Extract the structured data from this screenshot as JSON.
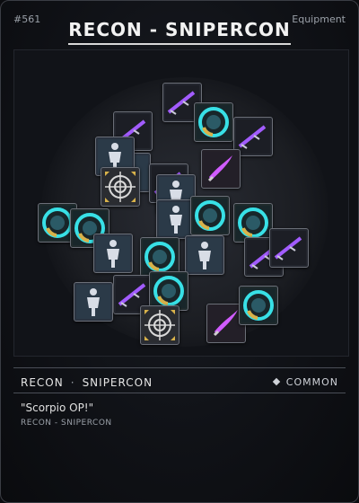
{
  "card": {
    "number": "#561",
    "type": "Equipment",
    "title": "RECON - SNIPERCON",
    "class": "RECON",
    "separator": "·",
    "loadout": "SNIPERCON",
    "rarity": "COMMON",
    "quote": "\"Scorpio OP!\"",
    "subtitle": "RECON - SNIPERCON"
  },
  "art": {
    "tiles": [
      {
        "kind": "weapon",
        "icon": "rifle-icon"
      },
      {
        "kind": "agent",
        "icon": "operator-icon"
      },
      {
        "kind": "weapon",
        "icon": "rifle-icon"
      },
      {
        "kind": "gear",
        "icon": "sensor-icon"
      },
      {
        "kind": "weapon",
        "icon": "rifle-icon"
      },
      {
        "kind": "agent",
        "icon": "operator-icon"
      },
      {
        "kind": "weapon",
        "icon": "rifle-icon"
      },
      {
        "kind": "scope",
        "icon": "crosshair-icon"
      },
      {
        "kind": "agent",
        "icon": "operator-icon"
      },
      {
        "kind": "blade",
        "icon": "blade-icon"
      },
      {
        "kind": "gear",
        "icon": "sensor-icon"
      },
      {
        "kind": "gear",
        "icon": "sensor-icon"
      },
      {
        "kind": "agent",
        "icon": "operator-icon"
      },
      {
        "kind": "gear",
        "icon": "sensor-icon"
      },
      {
        "kind": "gear",
        "icon": "sensor-icon"
      },
      {
        "kind": "weapon",
        "icon": "rifle-icon"
      },
      {
        "kind": "agent",
        "icon": "operator-icon"
      },
      {
        "kind": "gear",
        "icon": "sensor-icon"
      },
      {
        "kind": "agent",
        "icon": "operator-icon"
      },
      {
        "kind": "weapon",
        "icon": "rifle-icon"
      },
      {
        "kind": "gear",
        "icon": "sensor-icon"
      },
      {
        "kind": "scope",
        "icon": "crosshair-icon"
      },
      {
        "kind": "blade",
        "icon": "blade-icon"
      },
      {
        "kind": "gear",
        "icon": "sensor-icon"
      },
      {
        "kind": "agent",
        "icon": "operator-icon"
      },
      {
        "kind": "weapon",
        "icon": "rifle-icon"
      }
    ]
  },
  "colors": {
    "accent_purple": "#a25cff",
    "accent_cyan": "#38e0e6",
    "accent_gold": "#d8b24a",
    "accent_magenta": "#d05cff"
  }
}
